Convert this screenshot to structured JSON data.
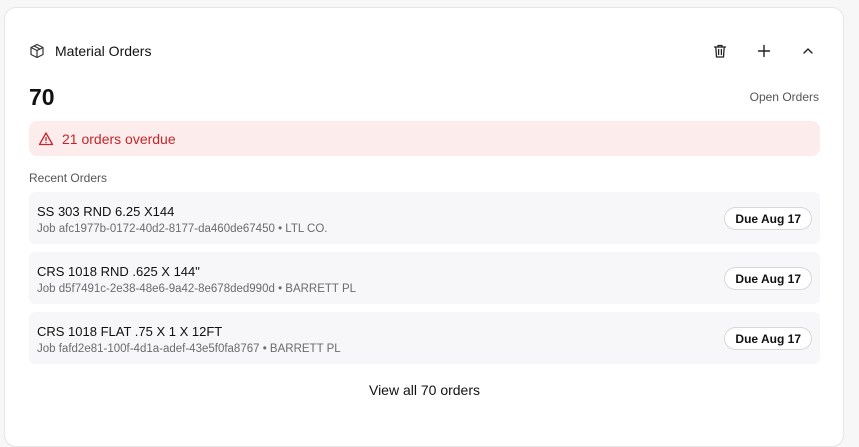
{
  "header": {
    "title": "Material Orders",
    "icons": [
      "box-icon",
      "trash-icon",
      "plus-icon",
      "chevron-up-icon"
    ]
  },
  "summary": {
    "count": "70",
    "count_label": "Open Orders"
  },
  "alert": {
    "text": "21 orders overdue",
    "color": "#c2262b",
    "background": "#fdecec",
    "icon": "warning-triangle-icon"
  },
  "recent": {
    "label": "Recent Orders",
    "items": [
      {
        "name": "SS 303 RND 6.25 X144",
        "meta": "Job afc1977b-0172-40d2-8177-da460de67450 • LTL CO.",
        "due": "Due Aug 17"
      },
      {
        "name": "CRS 1018 RND .625 X 144\"",
        "meta": "Job d5f7491c-2e38-48e6-9a42-8e678ded990d • BARRETT PL",
        "due": "Due Aug 17"
      },
      {
        "name": "CRS 1018 FLAT .75 X 1 X 12FT",
        "meta": "Job fafd2e81-100f-4d1a-adef-43e5f0fa8767 • BARRETT PL",
        "due": "Due Aug 17"
      }
    ]
  },
  "footer": {
    "view_all": "View all 70 orders"
  }
}
